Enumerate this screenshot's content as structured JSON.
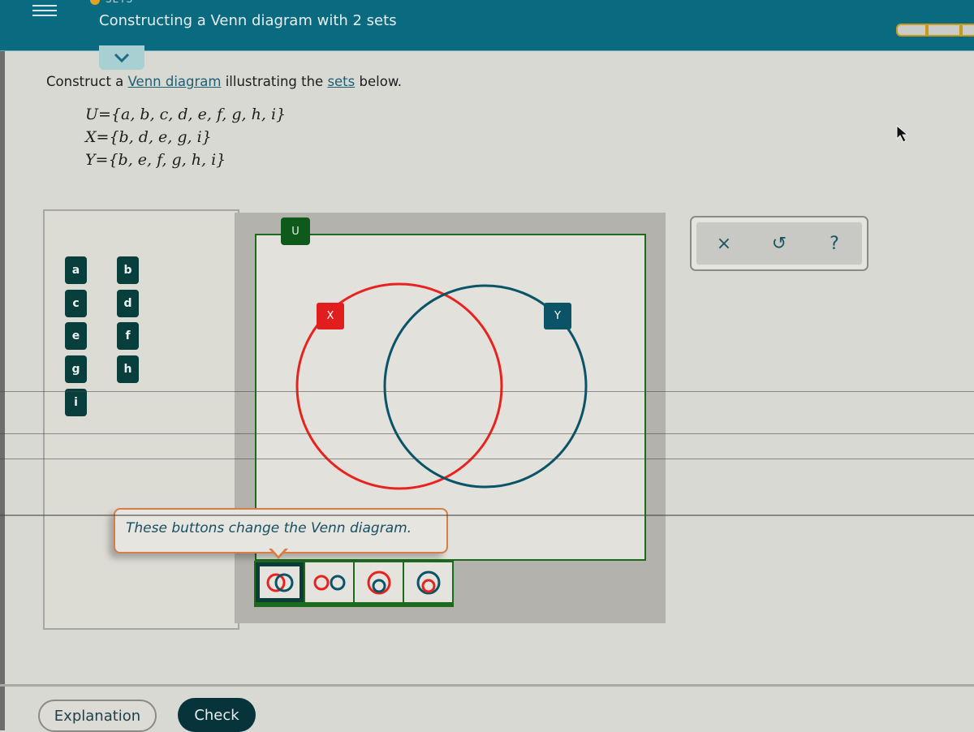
{
  "header": {
    "topic": "SETS",
    "title": "Constructing a Venn diagram with 2 sets",
    "progress_segments_filled": 0,
    "accent_color": "#0a6a80"
  },
  "question": {
    "prefix": "Construct a ",
    "link1": "Venn diagram",
    "middle": " illustrating the ",
    "link2": "sets",
    "suffix": " below.",
    "sets": [
      "U={a, b, c, d, e, f, g, h, i}",
      "X={b, d, e, g, i}",
      "Y={b, e, f, g, h, i}"
    ]
  },
  "palette": {
    "elements": [
      "a",
      "b",
      "c",
      "d",
      "e",
      "f",
      "g",
      "h",
      "i"
    ]
  },
  "diagram": {
    "universe_label": "U",
    "set_x_label": "X",
    "set_y_label": "Y",
    "set_x_color": "#e8231f",
    "set_y_color": "#0b5468",
    "universe_color": "#1d6a1d"
  },
  "tooltip": {
    "text": "These buttons change the Venn diagram."
  },
  "mode_buttons": [
    {
      "name": "overlapping",
      "selected": true
    },
    {
      "name": "disjoint",
      "selected": false
    },
    {
      "name": "y-subset-of-x",
      "selected": false
    },
    {
      "name": "x-subset-of-y",
      "selected": false
    }
  ],
  "tools": {
    "clear_icon": "×",
    "undo_icon": "↺",
    "help_icon": "?"
  },
  "footer": {
    "explanation_label": "Explanation",
    "check_label": "Check"
  }
}
